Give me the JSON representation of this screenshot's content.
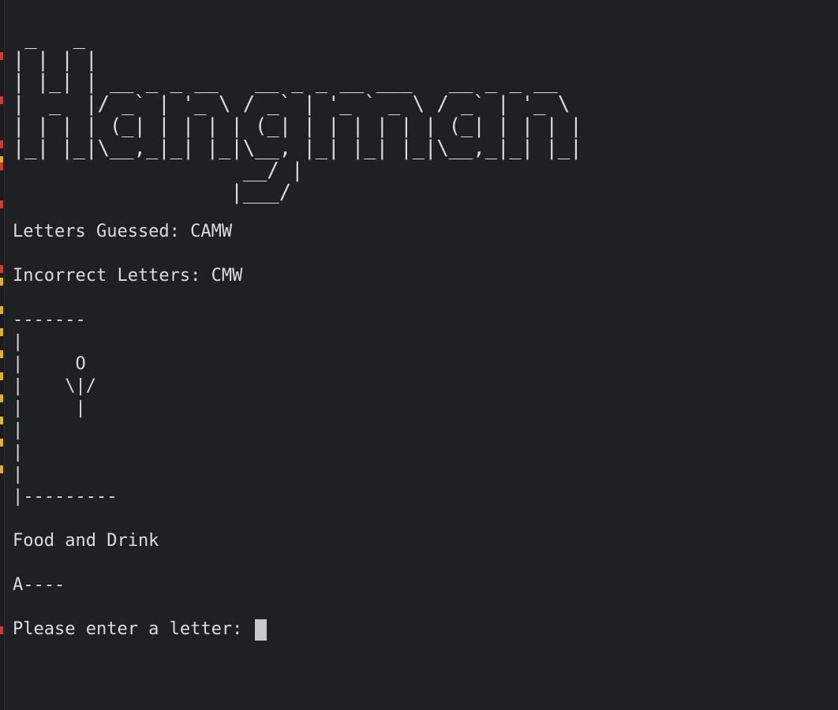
{
  "title_art": [
    " _   _",
    "| | | |",
    "| |_| | __ _ _ __   __ _ _ __ ___   __ _ _ __",
    "|  _  |/ _` | '_ \\ / _` | '_ ` _ \\ / _` | '_ \\",
    "| | | | (_| | | | | (_| | | | | | | (_| | | | |",
    "|_| |_|\\__,_|_| |_|\\__, |_| |_| |_|\\__,_|_| |_|",
    "                   __/ |",
    "                  |___/"
  ],
  "letters_guessed": "Letters Guessed: CAMW",
  "incorrect_letters": "Incorrect Letters: CMW",
  "gallows_art": [
    "-------",
    "|",
    "|     O",
    "|    \\|/",
    "|     |",
    "|",
    "|",
    "|",
    "|---------"
  ],
  "category": "Food and Drink",
  "word_progress": "A----",
  "prompt": "Please enter a letter: ",
  "colors": {
    "background": "#1f2023",
    "text": "#dcdcdc",
    "cursor": "#c9c9c9",
    "marker_red": "#d23a2c",
    "marker_yellow": "#e2b21f"
  }
}
